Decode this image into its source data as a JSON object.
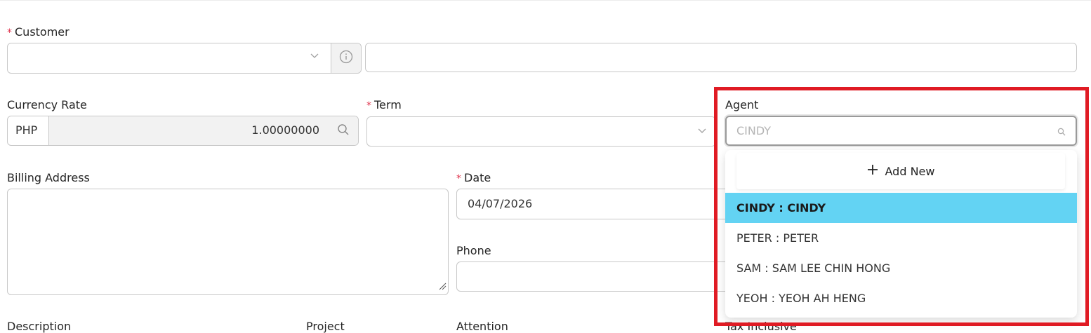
{
  "customer": {
    "label": "Customer",
    "required_mark": "*"
  },
  "currency_rate": {
    "label": "Currency Rate",
    "currency": "PHP",
    "value": "1.00000000"
  },
  "term": {
    "label": "Term",
    "required_mark": "*"
  },
  "agent": {
    "label": "Agent",
    "placeholder": "CINDY",
    "add_new_label": "Add New",
    "options": [
      {
        "label": "CINDY : CINDY",
        "selected": true
      },
      {
        "label": "PETER : PETER",
        "selected": false
      },
      {
        "label": "SAM : SAM LEE CHIN HONG",
        "selected": false
      },
      {
        "label": "YEOH : YEOH AH HENG",
        "selected": false
      }
    ]
  },
  "billing_address": {
    "label": "Billing Address"
  },
  "date": {
    "label": "Date",
    "required_mark": "*",
    "value": "04/07/2026"
  },
  "phone": {
    "label": "Phone"
  },
  "bottom_labels": {
    "description": "Description",
    "project": "Project",
    "attention": "Attention",
    "tax_inclusive": "Tax Inclusive"
  },
  "icons": {
    "customer_info": "info-icon",
    "currency_search": "search-icon",
    "agent_search": "search-icon",
    "dropdown_chevron": "chevron-down-icon",
    "add": "plus-icon",
    "resize": "resize-handle-icon"
  },
  "colors": {
    "required": "#e0304a",
    "selected_option": "#63d3f3",
    "highlight_border": "#e01b24"
  }
}
